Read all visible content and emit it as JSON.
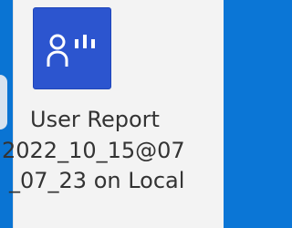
{
  "report_tile": {
    "icon_name": "user-report-icon",
    "label_line1": "User Report",
    "label_line2": "2022_10_15@07",
    "label_line3": "_07_23 on Local"
  }
}
